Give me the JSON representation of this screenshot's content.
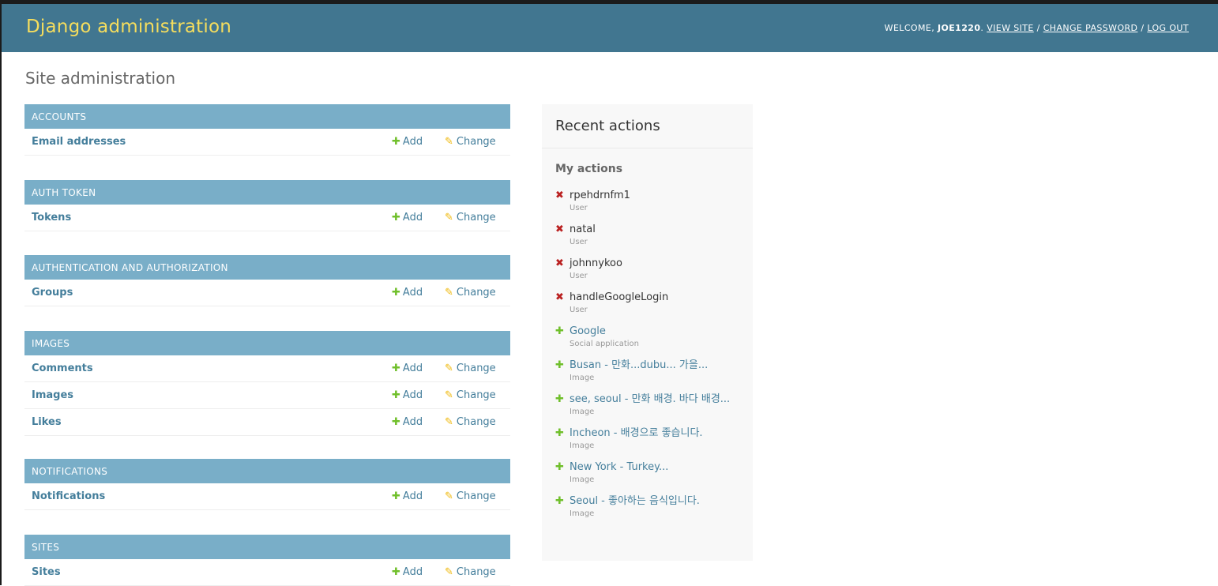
{
  "header": {
    "brand": "Django administration",
    "welcome": "WELCOME,",
    "username": "JOE1220",
    "view_site": "VIEW SITE",
    "change_password": "CHANGE PASSWORD",
    "log_out": "LOG OUT"
  },
  "page_title": "Site administration",
  "modules": [
    {
      "caption": "ACCOUNTS",
      "models": [
        {
          "name": "Email addresses",
          "add": "Add",
          "change": "Change"
        }
      ]
    },
    {
      "caption": "AUTH TOKEN",
      "models": [
        {
          "name": "Tokens",
          "add": "Add",
          "change": "Change"
        }
      ]
    },
    {
      "caption": "AUTHENTICATION AND AUTHORIZATION",
      "models": [
        {
          "name": "Groups",
          "add": "Add",
          "change": "Change"
        }
      ]
    },
    {
      "caption": "IMAGES",
      "models": [
        {
          "name": "Comments",
          "add": "Add",
          "change": "Change"
        },
        {
          "name": "Images",
          "add": "Add",
          "change": "Change"
        },
        {
          "name": "Likes",
          "add": "Add",
          "change": "Change"
        }
      ]
    },
    {
      "caption": "NOTIFICATIONS",
      "models": [
        {
          "name": "Notifications",
          "add": "Add",
          "change": "Change"
        }
      ]
    },
    {
      "caption": "SITES",
      "models": [
        {
          "name": "Sites",
          "add": "Add",
          "change": "Change"
        }
      ]
    }
  ],
  "recent": {
    "title": "Recent actions",
    "subtitle": "My actions",
    "actions": [
      {
        "type": "delete",
        "object": "rpehdrnfm1",
        "content_type": "User"
      },
      {
        "type": "delete",
        "object": "natal",
        "content_type": "User"
      },
      {
        "type": "delete",
        "object": "johnnykoo",
        "content_type": "User"
      },
      {
        "type": "delete",
        "object": "handleGoogleLogin",
        "content_type": "User"
      },
      {
        "type": "add",
        "object": "Google",
        "content_type": "Social application"
      },
      {
        "type": "add",
        "object": "Busan - 만화...dubu... 가을...",
        "content_type": "Image"
      },
      {
        "type": "add",
        "object": "see, seoul - 만화 배경. 바다 배경...",
        "content_type": "Image"
      },
      {
        "type": "add",
        "object": "Incheon - 배경으로 좋습니다.",
        "content_type": "Image"
      },
      {
        "type": "add",
        "object": "New York - Turkey...",
        "content_type": "Image"
      },
      {
        "type": "add",
        "object": "Seoul - 좋아하는 음식입니다.",
        "content_type": "Image"
      }
    ]
  },
  "icons": {
    "add": "plus-icon",
    "change": "pencil-icon",
    "delete": "x-icon"
  },
  "colors": {
    "header_bg": "#417690",
    "brand": "#f5dd5d",
    "caption_bg": "#79aec8",
    "link": "#447e9b",
    "add_green": "#70bf2b",
    "delete_red": "#ba2121",
    "pencil_yellow": "#efb80b"
  }
}
